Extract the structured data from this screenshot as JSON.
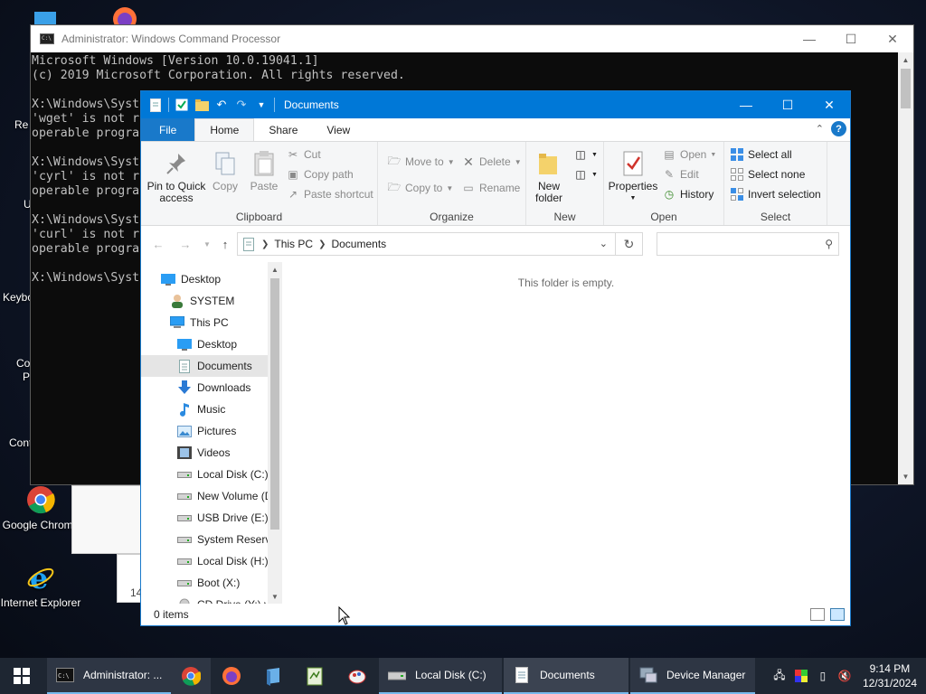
{
  "colors": {
    "explorer_title": "#0078d7",
    "file_tab": "#1979ca",
    "taskbar": "#1e2632",
    "cmd_bg": "#0c0c0c",
    "cmd_text": "#c0c0c0",
    "accent_underline": "#76b9ed"
  },
  "desktop": {
    "icons": [
      {
        "label": "Google Chrome",
        "icon": "chrome-icon"
      },
      {
        "label": "Internet Explorer",
        "icon": "internet-explorer-icon"
      }
    ],
    "fragments": [
      "Re",
      "U",
      "Keybo",
      "Co",
      "P",
      "Cont",
      "14"
    ]
  },
  "cmd": {
    "title": "Administrator: Windows Command Processor",
    "lines": [
      "Microsoft Windows [Version 10.0.19041.1]",
      "(c) 2019 Microsoft Corporation. All rights reserved.",
      "",
      "X:\\Windows\\Syst",
      "'wget' is not r",
      "operable progra",
      "",
      "X:\\Windows\\Syst",
      "'cyrl' is not r",
      "operable progra",
      "",
      "X:\\Windows\\Syst",
      "'curl' is not r",
      "operable progra",
      "",
      "X:\\Windows\\Syst"
    ]
  },
  "explorer": {
    "title": "Documents",
    "tabs": {
      "file": "File",
      "home": "Home",
      "share": "Share",
      "view": "View"
    },
    "help": "?",
    "ribbon": {
      "clipboard": {
        "label": "Clipboard",
        "pin": "Pin to Quick access",
        "copy": "Copy",
        "paste": "Paste",
        "cut": "Cut",
        "copy_path": "Copy path",
        "paste_shortcut": "Paste shortcut"
      },
      "organize": {
        "label": "Organize",
        "move_to": "Move to",
        "copy_to": "Copy to",
        "delete": "Delete",
        "rename": "Rename"
      },
      "new": {
        "label": "New",
        "new_folder": "New folder"
      },
      "open": {
        "label": "Open",
        "properties": "Properties",
        "open": "Open",
        "edit": "Edit",
        "history": "History"
      },
      "select": {
        "label": "Select",
        "select_all": "Select all",
        "select_none": "Select none",
        "invert": "Invert selection"
      }
    },
    "address": {
      "crumbs": [
        "This PC",
        "Documents"
      ],
      "search_placeholder": ""
    },
    "nav": [
      {
        "label": "Desktop",
        "icon": "desktop-icon",
        "indent": 0
      },
      {
        "label": "SYSTEM",
        "icon": "user-icon",
        "indent": 1
      },
      {
        "label": "This PC",
        "icon": "computer-icon",
        "indent": 1
      },
      {
        "label": "Desktop",
        "icon": "desktop-icon",
        "indent": 2
      },
      {
        "label": "Documents",
        "icon": "document-icon",
        "indent": 2,
        "selected": true
      },
      {
        "label": "Downloads",
        "icon": "download-icon",
        "indent": 2
      },
      {
        "label": "Music",
        "icon": "music-icon",
        "indent": 2
      },
      {
        "label": "Pictures",
        "icon": "pictures-icon",
        "indent": 2
      },
      {
        "label": "Videos",
        "icon": "videos-icon",
        "indent": 2
      },
      {
        "label": "Local Disk (C:)",
        "icon": "drive-icon",
        "indent": 2
      },
      {
        "label": "New Volume (D",
        "icon": "drive-icon",
        "indent": 2
      },
      {
        "label": "USB Drive (E:)",
        "icon": "drive-icon",
        "indent": 2
      },
      {
        "label": "System Reserve",
        "icon": "drive-icon",
        "indent": 2
      },
      {
        "label": "Local Disk (H:)",
        "icon": "drive-icon",
        "indent": 2
      },
      {
        "label": "Boot (X:)",
        "icon": "drive-icon",
        "indent": 2
      },
      {
        "label": "CD Drive (Y:) vi",
        "icon": "cd-drive-icon",
        "indent": 2
      }
    ],
    "empty_message": "This folder is empty.",
    "status": "0 items"
  },
  "taskbar": {
    "buttons": [
      {
        "label": "Administrator: ...",
        "icon": "cmd-icon"
      },
      {
        "label": "Local Disk (C:)",
        "icon": "drive-icon"
      },
      {
        "label": "Documents",
        "icon": "document-icon"
      },
      {
        "label": "Device Manager",
        "icon": "device-manager-icon"
      }
    ],
    "time": "9:14 PM",
    "date": "12/31/2024"
  }
}
